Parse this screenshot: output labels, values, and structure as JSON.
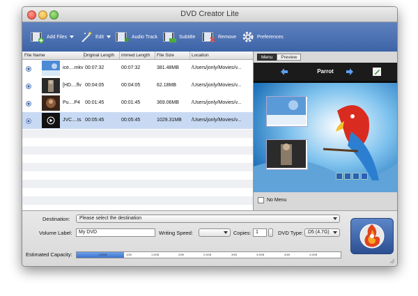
{
  "window": {
    "title": "DVD Creator Lite"
  },
  "toolbar": {
    "add_files": "Add Files",
    "edit": "Edit",
    "audio_track": "Audio Track",
    "subtitle": "Subtitle",
    "remove": "Remove",
    "preferences": "Preferences"
  },
  "list": {
    "columns": [
      "File Name",
      "Original Length",
      "Trimmed Length",
      "File Size",
      "Location"
    ],
    "column_display": [
      "File Name",
      "Original Length",
      "immed Length",
      "File Size",
      "Location"
    ],
    "rows": [
      {
        "name": "ice....mkv",
        "orig": "00:07:32",
        "trim": "00:07:32",
        "size": "381.48MB",
        "loc": "/Users/jonly/Movies/v...",
        "selected": false
      },
      {
        "name": "[HD....flv",
        "orig": "00:04:05",
        "trim": "00:04:05",
        "size": "62.18MB",
        "loc": "/Users/jonly/Movies/v...",
        "selected": false
      },
      {
        "name": "Pu....P4",
        "orig": "00:01:45",
        "trim": "00:01:45",
        "size": "369.06MB",
        "loc": "/Users/jonly/Movies/v...",
        "selected": false
      },
      {
        "name": "JVC....ts",
        "orig": "00:05:45",
        "trim": "00:05:45",
        "size": "1029.31MB",
        "loc": "/Users/jonly/Movies/v...",
        "selected": true
      }
    ]
  },
  "preview": {
    "tabs": [
      "Menu",
      "Preview"
    ],
    "active_tab": "Menu",
    "menu_title": "Parrot",
    "no_menu_label": "No Menu"
  },
  "bottom": {
    "destination_label": "Destination:",
    "destination_value": "Please select the destination",
    "volume_label": "Volume Label:",
    "volume_value": "My DVD",
    "writing_speed_label": "Writing Speed:",
    "writing_speed_value": "",
    "copies_label": "Copies:",
    "copies_value": "1",
    "dvd_type_label": "DVD Type:",
    "dvd_type_value": "D5 (4.7G)",
    "capacity_label": "Estimated Capacity:",
    "capacity_ticks": [
      "0.5GB",
      "1GB",
      "1.5GB",
      "2GB",
      "2.5GB",
      "3GB",
      "3.5GB",
      "4GB",
      "4.5GB"
    ],
    "capacity_fill_fraction": 0.18
  },
  "colors": {
    "accent": "#3d63a8",
    "selection": "#c8daf3"
  }
}
